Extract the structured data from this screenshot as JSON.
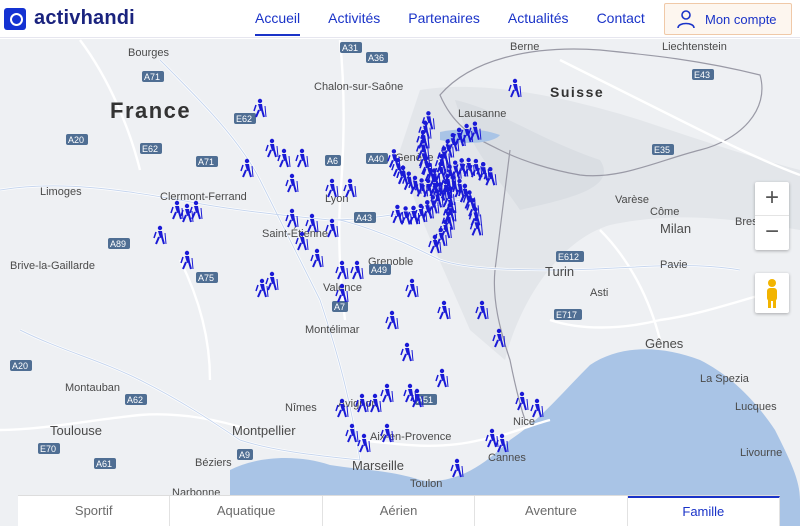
{
  "brand": {
    "name": "activhandi"
  },
  "nav": [
    {
      "label": "Accueil",
      "active": true
    },
    {
      "label": "Activités",
      "active": false
    },
    {
      "label": "Partenaires",
      "active": false
    },
    {
      "label": "Actualités",
      "active": false
    },
    {
      "label": "Contact",
      "active": false
    }
  ],
  "account": {
    "label": "Mon compte"
  },
  "map": {
    "countries": [
      "France",
      "Suisse"
    ],
    "places": [
      "Bourges",
      "Chalon-sur-Saône",
      "Berne",
      "Liechtenstein",
      "Lausanne",
      "Genève",
      "Limoges",
      "Clermont-Ferrand",
      "Lyon",
      "Saint-Étienne",
      "Brive-la-Gaillarde",
      "Grenoble",
      "Valence",
      "Montélimar",
      "Varèse",
      "Côme",
      "Brescia",
      "Milan",
      "Turin",
      "Pavie",
      "Asti",
      "Gênes",
      "La Spezia",
      "Montauban",
      "Nîmes",
      "Avignon",
      "Toulouse",
      "Montpellier",
      "Aix-en-Provence",
      "Marseille",
      "Béziers",
      "Toulon",
      "Nice",
      "Cannes",
      "Lucques",
      "Livourne",
      "Narbonne"
    ],
    "roads": [
      "E62",
      "A71",
      "A31",
      "A36",
      "E43",
      "A20",
      "E62",
      "A71",
      "A6",
      "A40",
      "E35",
      "A43",
      "A89",
      "A75",
      "A49",
      "A7",
      "E612",
      "E717",
      "A20",
      "A62",
      "E70",
      "A61",
      "A9",
      "A51"
    ],
    "zoom_in": "+",
    "zoom_out": "−",
    "marker_color": "#1a1ad6"
  },
  "tabs": [
    {
      "label": "Sportif",
      "active": false
    },
    {
      "label": "Aquatique",
      "active": false
    },
    {
      "label": "Aérien",
      "active": false
    },
    {
      "label": "Aventure",
      "active": false
    },
    {
      "label": "Famille",
      "active": true
    }
  ]
}
